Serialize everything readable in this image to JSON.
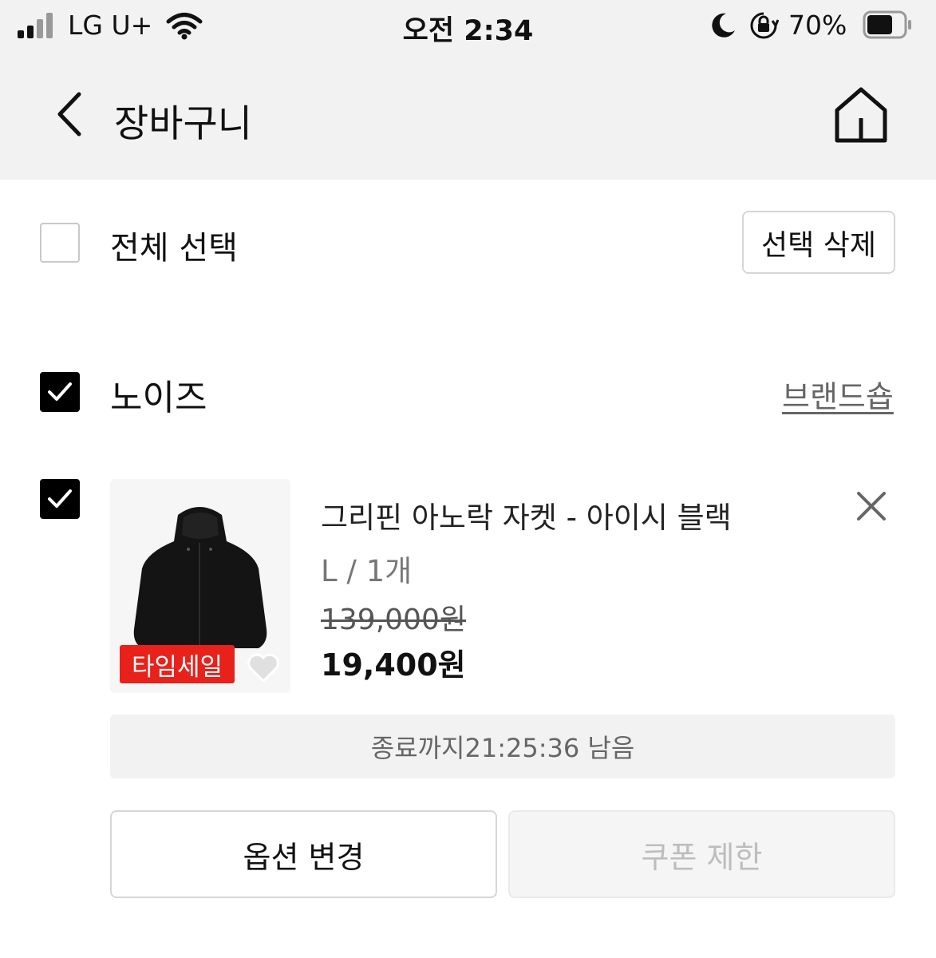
{
  "status_bar": {
    "carrier": "LG U+",
    "time": "오전 2:34",
    "battery": "70%",
    "battery_level": 0.7,
    "icons": [
      "signal-icon",
      "wifi-icon",
      "moon-icon",
      "rotation-lock-icon",
      "battery-icon"
    ]
  },
  "header": {
    "title": "장바구니",
    "back_icon": "chevron-left-icon",
    "home_icon": "home-icon"
  },
  "select_all": {
    "label": "전체 선택",
    "checked": false,
    "delete_selected_label": "선택 삭제"
  },
  "brand_group": {
    "name": "노이즈",
    "checked": true,
    "brandshop_link": "브랜드숍"
  },
  "cart_item": {
    "checked": true,
    "badge": "타임세일",
    "name": "그리핀 아노락 자켓 - 아이시 블랙",
    "option": "L / 1개",
    "original_price": "139,000원",
    "sale_price": "19,400원",
    "timer_text": "종료까지21:25:36 남음",
    "option_change_label": "옵션 변경",
    "coupon_label": "쿠폰 제한",
    "remove_icon": "close-icon",
    "wishlist_icon": "heart-icon"
  },
  "colors": {
    "badge": "#e8211b",
    "header_bg": "#f2f2f2",
    "checkbox_on": "#000000"
  }
}
